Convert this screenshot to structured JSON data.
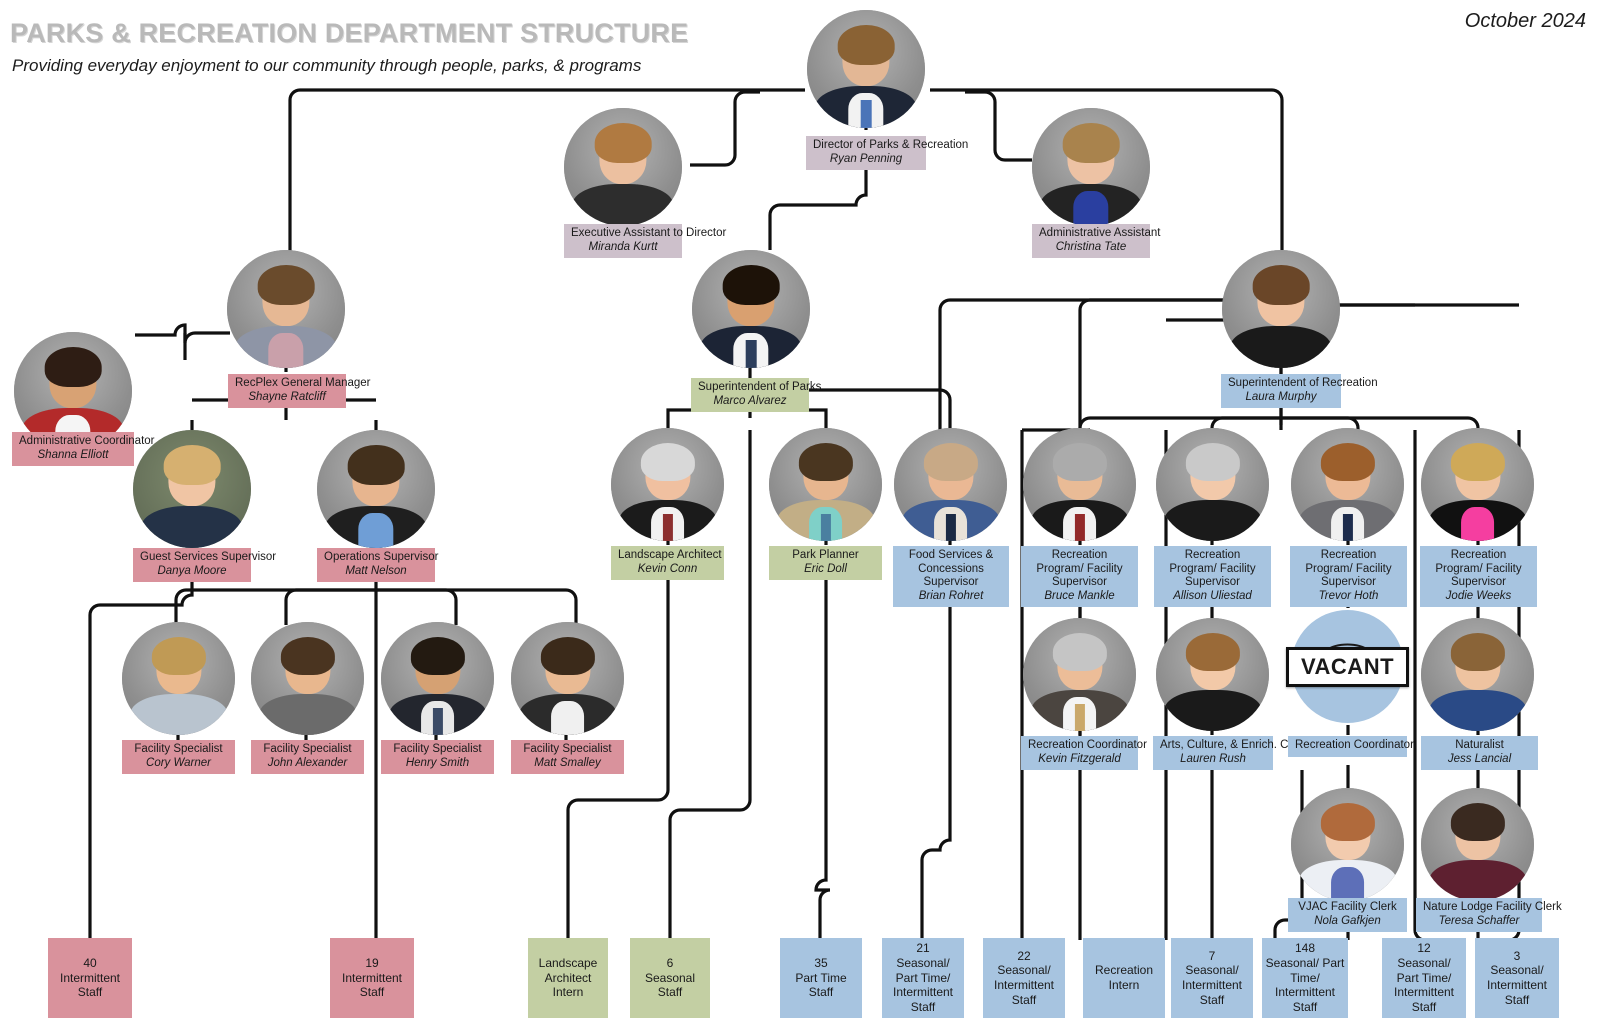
{
  "header": {
    "title": "PARKS & RECREATION DEPARTMENT STRUCTURE",
    "subtitle": "Providing everyday enjoyment to our community through people, parks, & programs",
    "date": "October 2024"
  },
  "colors": {
    "director": "#cdc0cb",
    "recplex": "#d9929c",
    "parks": "#c3cfa3",
    "recreation": "#a7c4e0",
    "line": "#101010",
    "title_grey": "#b9b9b9"
  },
  "vacant_label": "VACANT",
  "nodes": {
    "director": {
      "title": "Director of Parks & Recreation",
      "name": "Ryan Penning"
    },
    "exec_assistant": {
      "title": "Executive Assistant to Director",
      "name": "Miranda Kurtt"
    },
    "admin_assistant": {
      "title": "Administrative Assistant",
      "name": "Christina Tate"
    },
    "admin_coord": {
      "title": "Administrative Coordinator",
      "name": "Shanna Elliott"
    },
    "recplex_gm": {
      "title": "RecPlex General Manager",
      "name": "Shayne Ratcliff"
    },
    "guest_services": {
      "title": "Guest Services Supervisor",
      "name": "Danya Moore"
    },
    "operations": {
      "title": "Operations Supervisor",
      "name": "Matt Nelson"
    },
    "fac_spec_1": {
      "title": "Facility Specialist",
      "name": "Cory Warner"
    },
    "fac_spec_2": {
      "title": "Facility Specialist",
      "name": "John Alexander"
    },
    "fac_spec_3": {
      "title": "Facility Specialist",
      "name": "Henry Smith"
    },
    "fac_spec_4": {
      "title": "Facility Specialist",
      "name": "Matt Smalley"
    },
    "supt_parks": {
      "title": "Superintendent of Parks",
      "name": "Marco Alvarez"
    },
    "landscape_arch": {
      "title": "Landscape Architect",
      "name": "Kevin Conn"
    },
    "park_planner": {
      "title": "Park Planner",
      "name": "Eric Doll"
    },
    "food_services": {
      "title": "Food  Services & Concessions Supervisor",
      "name": "Brian Rohret"
    },
    "supt_rec": {
      "title": "Superintendent of Recreation",
      "name": "Laura Murphy"
    },
    "rec_sup_1": {
      "title": "Recreation Program/ Facility Supervisor",
      "name": "Bruce Mankle"
    },
    "rec_sup_2": {
      "title": "Recreation Program/ Facility Supervisor",
      "name": "Allison Uliestad"
    },
    "rec_sup_3": {
      "title": "Recreation Program/ Facility Supervisor",
      "name": "Trevor Hoth"
    },
    "rec_sup_4": {
      "title": "Recreation Program/ Facility Supervisor",
      "name": "Jodie Weeks"
    },
    "rec_coord_1": {
      "title": "Recreation Coordinator",
      "name": "Kevin Fitzgerald"
    },
    "arts_coord": {
      "title": "Arts, Culture, & Enrich. Coord.",
      "name": "Lauren Rush"
    },
    "rec_coord_vacant": {
      "title": "Recreation Coordinator",
      "name": ""
    },
    "naturalist": {
      "title": "Naturalist",
      "name": "Jess Lancial"
    },
    "vjac_clerk": {
      "title": "VJAC Facility Clerk",
      "name": "Nola Gafkjen"
    },
    "nature_clerk": {
      "title": "Nature Lodge Facility Clerk",
      "name": "Teresa Schaffer"
    }
  },
  "leaves": {
    "leaf_1": {
      "count": "40",
      "text": "Intermittent Staff"
    },
    "leaf_2": {
      "count": "19",
      "text": "Intermittent Staff"
    },
    "leaf_3": {
      "count": "",
      "text": "Landscape Architect Intern"
    },
    "leaf_4": {
      "count": "6",
      "text": "Seasonal Staff"
    },
    "leaf_5": {
      "count": "35",
      "text": "Part Time Staff"
    },
    "leaf_6": {
      "count": "21",
      "text": "Seasonal/ Part Time/ Intermittent Staff"
    },
    "leaf_7": {
      "count": "22",
      "text": "Seasonal/ Intermittent Staff"
    },
    "leaf_8": {
      "count": "",
      "text": "Recreation Intern"
    },
    "leaf_9": {
      "count": "7",
      "text": "Seasonal/ Intermittent Staff"
    },
    "leaf_10": {
      "count": "148",
      "text": "Seasonal/ Part Time/ Intermittent Staff"
    },
    "leaf_11": {
      "count": "12",
      "text": "Seasonal/ Part Time/ Intermittent Staff"
    },
    "leaf_12": {
      "count": "3",
      "text": "Seasonal/ Intermittent Staff"
    }
  }
}
